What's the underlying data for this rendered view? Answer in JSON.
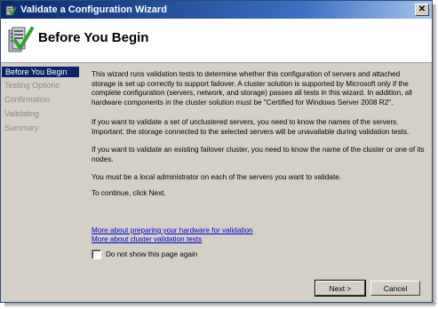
{
  "window": {
    "title": "Validate a Configuration Wizard",
    "close_glyph": "✕"
  },
  "header": {
    "heading": "Before You Begin"
  },
  "nav": {
    "items": [
      {
        "label": "Before You Begin",
        "active": true
      },
      {
        "label": "Testing Options",
        "active": false
      },
      {
        "label": "Confirmation",
        "active": false
      },
      {
        "label": "Validating",
        "active": false
      },
      {
        "label": "Summary",
        "active": false
      }
    ]
  },
  "content": {
    "paragraphs": [
      "This wizard runs validation tests to determine whether this configuration of servers and attached storage is set up correctly to support failover. A cluster solution is supported by Microsoft only if the complete configuration (servers, network, and storage) passes all tests in this wizard. In addition, all hardware components in the cluster solution must be \"Certified for Windows Server 2008 R2\".",
      "If you want to validate a set of unclustered servers, you need to know the names of the servers. Important: the storage connected to the selected servers will be unavailable during validation tests.",
      "If you want to validate an existing failover cluster, you need to know the name of the cluster or one of its nodes.",
      "You must be a local administrator on each of the servers you want to validate.",
      "To continue, click Next."
    ],
    "links": [
      "More about preparing your hardware for validation",
      "More about cluster validation tests"
    ],
    "checkbox_label": "Do not show this page again",
    "checkbox_checked": false
  },
  "buttons": {
    "next": "Next >",
    "cancel": "Cancel"
  },
  "colors": {
    "titlebar_start": "#0b2a6e",
    "nav_active_bg": "#0a246a",
    "link": "#0000cc",
    "dialog_bg": "#d4d0c8"
  }
}
